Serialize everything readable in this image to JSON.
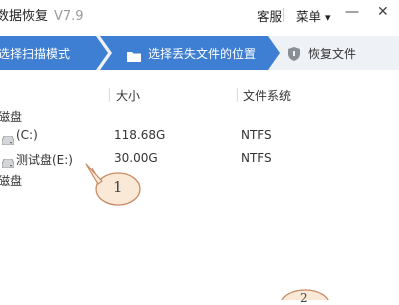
{
  "app": {
    "title": "数据恢复",
    "version": "V7.9"
  },
  "titlebar": {
    "support": "客服",
    "menu": "菜单",
    "menu_arrow": "▾",
    "minimize": "—",
    "close": "✕"
  },
  "steps": [
    {
      "label": "选择扫描模式",
      "state": "done"
    },
    {
      "label": "选择丢失文件的位置",
      "state": "active",
      "icon": "folder-icon"
    },
    {
      "label": "恢复文件",
      "state": "pending",
      "icon": "shield-icon"
    }
  ],
  "table": {
    "columns": {
      "size": "大小",
      "fs": "文件系统"
    },
    "groups": [
      {
        "label": "磁盘",
        "rows": [
          {
            "name": "(C:)",
            "size": "118.68G",
            "fs": "NTFS"
          },
          {
            "name": "测试盘(E:)",
            "size": "30.00G",
            "fs": "NTFS"
          }
        ]
      },
      {
        "label": "磁盘"
      }
    ]
  },
  "annotations": [
    {
      "label": "1"
    },
    {
      "label": "2"
    }
  ],
  "colors": {
    "accent": "#3f7fd3",
    "steps_bg": "#eef1f5",
    "annotation_fill": "#fbe9d7",
    "annotation_stroke": "#c98a63"
  }
}
